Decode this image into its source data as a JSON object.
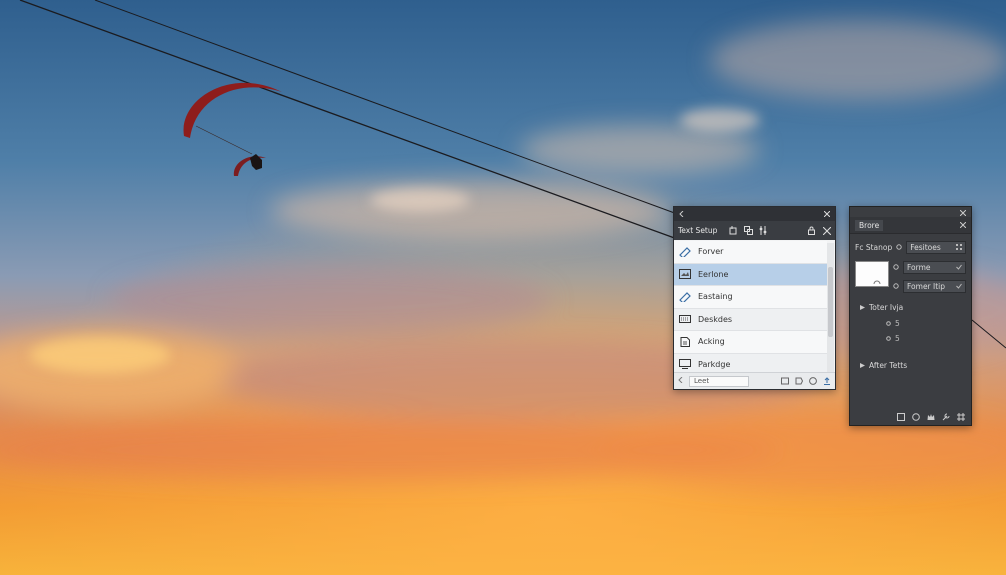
{
  "panel_a": {
    "title": "Text Setup",
    "items": [
      {
        "label": "Forver",
        "icon": "pen-icon",
        "selected": false
      },
      {
        "label": "Eerlone",
        "icon": "image-icon",
        "selected": true
      },
      {
        "label": "Eastaing",
        "icon": "pen-icon",
        "selected": false
      },
      {
        "label": "Deskdes",
        "icon": "keyboard-icon",
        "selected": false
      },
      {
        "label": "Acking",
        "icon": "document-icon",
        "selected": false
      },
      {
        "label": "Parkdge",
        "icon": "monitor-icon",
        "selected": false
      }
    ],
    "footer_field": "Leet"
  },
  "panel_b": {
    "tab": "Brore",
    "row1_label": "Fc Stanop",
    "row1_value": "Fesitoes",
    "opt1": "Forme",
    "opt2": "Fomer Itip",
    "section1": "Toter Ivja",
    "sub1": "5",
    "sub2": "5",
    "section2": "After Tetts"
  },
  "colors": {
    "panel_a_bg": "#f2f3f4",
    "panel_b_bg": "#3b3d41",
    "selection": "#b7cfe8",
    "accent_icon": "#3a6ea5"
  }
}
